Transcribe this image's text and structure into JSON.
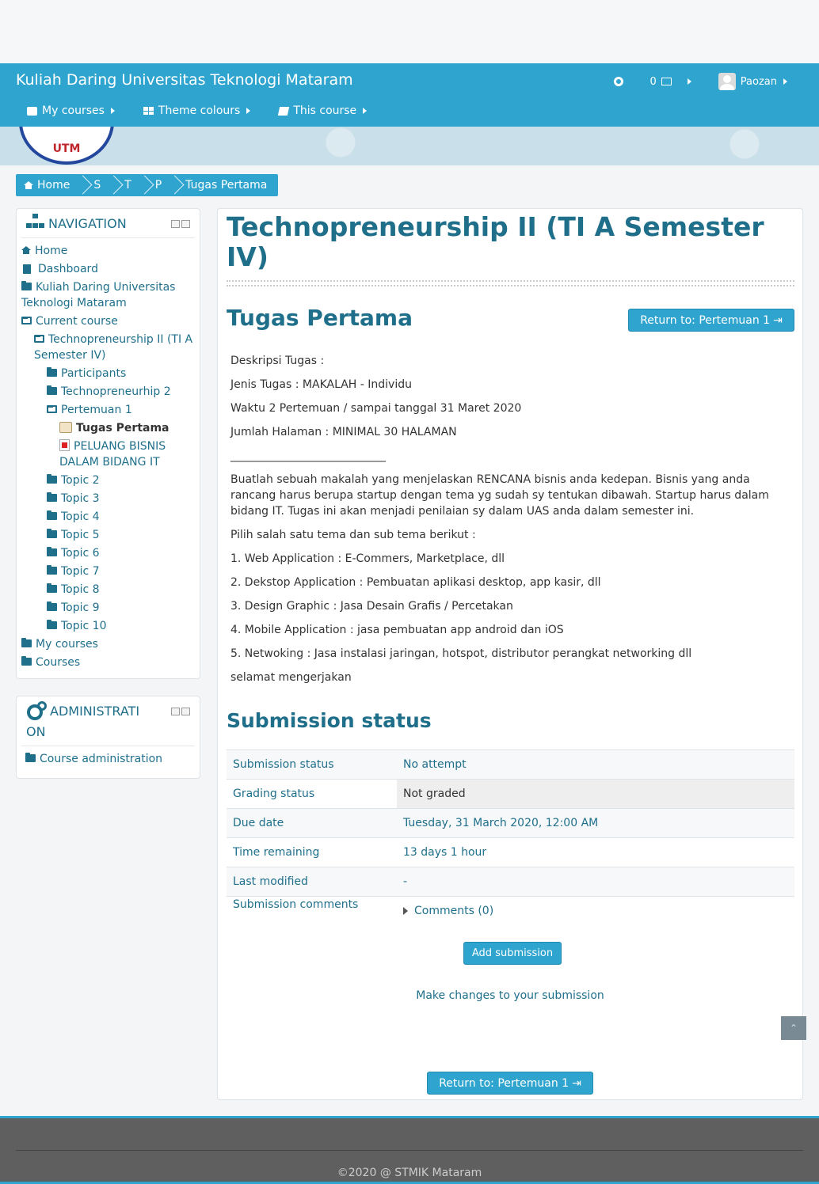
{
  "site": {
    "brand": "Kuliah Daring Universitas Teknologi Mataram",
    "logo_text": "UTM"
  },
  "top_nav": {
    "messages_count": "0",
    "user_name": "Paozan"
  },
  "menu": {
    "my_courses": "My courses",
    "theme_colours": "Theme colours",
    "this_course": "This course"
  },
  "breadcrumb": [
    "Home",
    "S",
    "T",
    "P",
    "Tugas Pertama"
  ],
  "navigation_block": {
    "title": "NAVIGATION",
    "items": {
      "home": "Home",
      "dashboard": "Dashboard",
      "site": "Kuliah Daring Universitas Teknologi Mataram",
      "current_course": "Current course",
      "course": "Technopreneurship II (TI A Semester IV)",
      "participants": "Participants",
      "technopreneurhip2": "Technopreneurhip 2",
      "pertemuan1": "Pertemuan 1",
      "tugas_pertama": "Tugas Pertama",
      "peluang": "PELUANG BISNIS DALAM BIDANG IT",
      "topics": [
        "Topic 2",
        "Topic 3",
        "Topic 4",
        "Topic 5",
        "Topic 6",
        "Topic 7",
        "Topic 8",
        "Topic 9",
        "Topic 10"
      ],
      "my_courses": "My courses",
      "courses": "Courses"
    }
  },
  "admin_block": {
    "title_line1": "ADMINISTRATI",
    "title_line2": "ON",
    "course_admin": "Course administration"
  },
  "main": {
    "course_title": "Technopreneurship II (TI A Semester IV)",
    "assignment_title": "Tugas Pertama",
    "return_button": "Return to: Pertemuan 1",
    "description": [
      "Deskripsi Tugas :",
      "Jenis Tugas : MAKALAH - Individu",
      "Waktu 2 Pertemuan / sampai tanggal 31 Maret 2020",
      "Jumlah Halaman : MINIMAL 30 HALAMAN",
      "____________________________",
      "Buatlah sebuah makalah yang menjelaskan RENCANA bisnis anda kedepan.  Bisnis yang anda rancang harus berupa startup dengan tema yg sudah sy tentukan dibawah. Startup harus dalam bidang IT. Tugas ini akan menjadi penilaian sy dalam UAS anda dalam semester ini.",
      "Pilih salah satu tema dan sub tema berikut :",
      "1. Web Application : E-Commers, Marketplace, dll",
      "2. Dekstop Application : Pembuatan aplikasi desktop, app kasir, dll",
      "3. Design Graphic : Jasa Desain Grafis / Percetakan",
      "4. Mobile Application : jasa pembuatan app android dan iOS",
      "5. Netwoking : Jasa instalasi jaringan, hotspot, distributor perangkat networking dll",
      "selamat mengerjakan"
    ],
    "submission_heading": "Submission status",
    "status_rows": [
      {
        "label": "Submission status",
        "value": "No attempt"
      },
      {
        "label": "Grading status",
        "value": "Not graded"
      },
      {
        "label": "Due date",
        "value": "Tuesday, 31 March 2020, 12:00 AM"
      },
      {
        "label": "Time remaining",
        "value": "13 days 1 hour"
      },
      {
        "label": "Last modified",
        "value": "-"
      },
      {
        "label": "Submission comments",
        "value": "Comments (0)"
      }
    ],
    "add_submission": "Add submission",
    "make_changes": "Make changes to your submission"
  },
  "footer": {
    "copyright": "©2020 @ STMIK Mataram"
  },
  "colors": {
    "primary": "#2fa4cf",
    "heading": "#1f6f8b"
  }
}
